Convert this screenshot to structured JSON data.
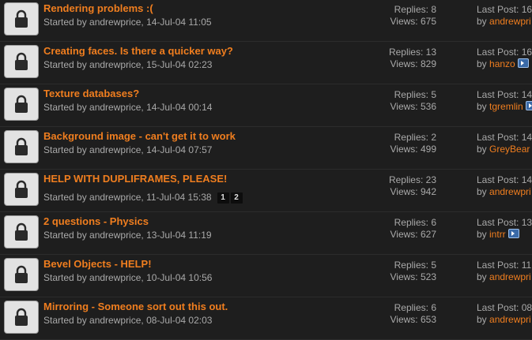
{
  "topics": [
    {
      "title": "Rendering problems :(",
      "starter_prefix": "Started by ",
      "author": "andrewprice",
      "date": ", 14-Jul-04 11:05",
      "replies": "Replies: 8",
      "views": "Views: 675",
      "last_post": "Last Post: 16",
      "by": "by ",
      "last_user": "andrewpri",
      "pages": [],
      "goto": false
    },
    {
      "title": "Creating faces. Is there a quicker way?",
      "starter_prefix": "Started by ",
      "author": "andrewprice",
      "date": ", 15-Jul-04 02:23",
      "replies": "Replies: 13",
      "views": "Views: 829",
      "last_post": "Last Post: 16",
      "by": "by ",
      "last_user": "hanzo",
      "pages": [],
      "goto": true
    },
    {
      "title": "Texture databases?",
      "starter_prefix": "Started by ",
      "author": "andrewprice",
      "date": ", 14-Jul-04 00:14",
      "replies": "Replies: 5",
      "views": "Views: 536",
      "last_post": "Last Post: 14",
      "by": "by ",
      "last_user": "tgremlin",
      "pages": [],
      "goto": true
    },
    {
      "title": "Background image - can't get it to work",
      "starter_prefix": "Started by ",
      "author": "andrewprice",
      "date": ", 14-Jul-04 07:57",
      "replies": "Replies: 2",
      "views": "Views: 499",
      "last_post": "Last Post: 14",
      "by": "by ",
      "last_user": "GreyBear",
      "pages": [],
      "goto": false
    },
    {
      "title": "HELP WITH DUPLIFRAMES, PLEASE!",
      "starter_prefix": "Started by ",
      "author": "andrewprice",
      "date": ", 11-Jul-04 15:38",
      "replies": "Replies: 23",
      "views": "Views: 942",
      "last_post": "Last Post: 14",
      "by": "by ",
      "last_user": "andrewpri",
      "pages": [
        "1",
        "2"
      ],
      "goto": false
    },
    {
      "title": "2 questions - Physics",
      "starter_prefix": "Started by ",
      "author": "andrewprice",
      "date": ", 13-Jul-04 11:19",
      "replies": "Replies: 6",
      "views": "Views: 627",
      "last_post": "Last Post: 13",
      "by": "by ",
      "last_user": "intrr",
      "pages": [],
      "goto": true
    },
    {
      "title": "Bevel Objects - HELP!",
      "starter_prefix": "Started by ",
      "author": "andrewprice",
      "date": ", 10-Jul-04 10:56",
      "replies": "Replies: 5",
      "views": "Views: 523",
      "last_post": "Last Post: 11",
      "by": "by ",
      "last_user": "andrewpri",
      "pages": [],
      "goto": false
    },
    {
      "title": "Mirroring - Someone sort out this out.",
      "starter_prefix": "Started by ",
      "author": "andrewprice",
      "date": ", 08-Jul-04 02:03",
      "replies": "Replies: 6",
      "views": "Views: 653",
      "last_post": "Last Post: 08",
      "by": "by ",
      "last_user": "andrewpri",
      "pages": [],
      "goto": false
    }
  ],
  "icons": {
    "status": "lock-icon",
    "goto": "go-to-last-post-icon"
  },
  "colors": {
    "link": "#f07e1f",
    "background": "#1e1e1e",
    "text": "#a9a9a9"
  }
}
